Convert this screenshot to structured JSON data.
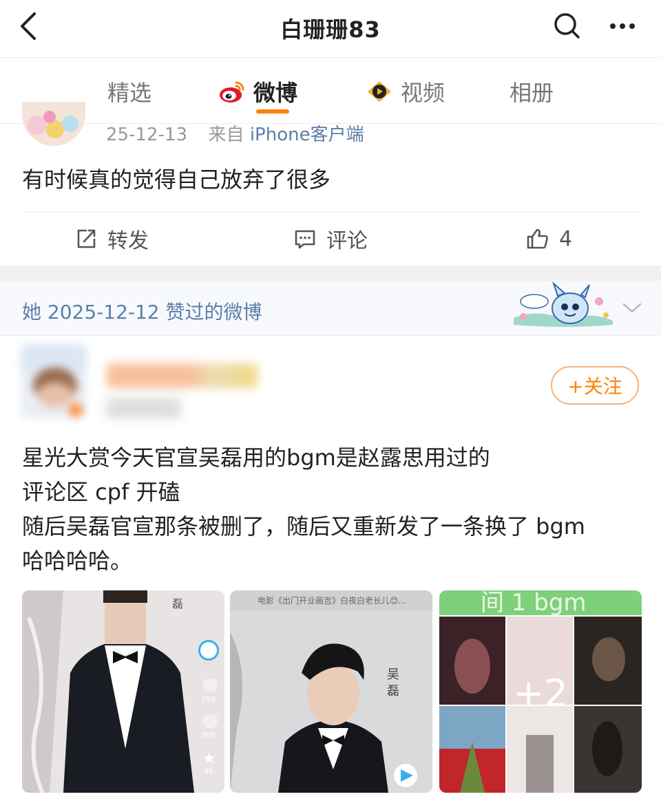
{
  "header": {
    "title": "白珊珊83",
    "back_icon": "back-chevron-icon",
    "search_icon": "search-icon",
    "more_icon": "more-dots-icon"
  },
  "tabs": [
    {
      "label": "精选",
      "active": false
    },
    {
      "label": "微博",
      "active": true,
      "icon": "weibo-logo-icon"
    },
    {
      "label": "视频",
      "active": false,
      "icon": "video-play-icon"
    },
    {
      "label": "相册",
      "active": false
    }
  ],
  "post1": {
    "date": "25-12-13",
    "source_prefix": "来自",
    "source": "iPhone客户端",
    "text": "有时候真的觉得自己放弃了很多",
    "actions": {
      "repost_label": "转发",
      "comment_label": "评论",
      "like_count": "4"
    }
  },
  "liked_section": {
    "text": "她 2025-12-12 赞过的微博"
  },
  "post2": {
    "follow_label": "+关注",
    "lines": [
      "星光大赏今天官宣吴磊用的bgm是赵露思用过的",
      "评论区 cpf 开磕",
      "随后吴磊官宣那条被删了，随后又重新发了一条换了 bgm",
      "哈哈哈哈。"
    ],
    "images": {
      "pic1_side_char": "磊",
      "pic1_counts": [
        "355",
        "305",
        "46"
      ],
      "pic2_top_caption": "电影《出门开业画吉》白夜白老长儿😊...",
      "pic2_vertical": "吴磊",
      "pic3_top_text": "间 1 bgm",
      "extra_count": "+2"
    }
  },
  "colors": {
    "accent": "#ff8200",
    "link_blue": "#5a7ea8",
    "meta_gray": "#999999",
    "section_bg": "#f7f9fc"
  }
}
